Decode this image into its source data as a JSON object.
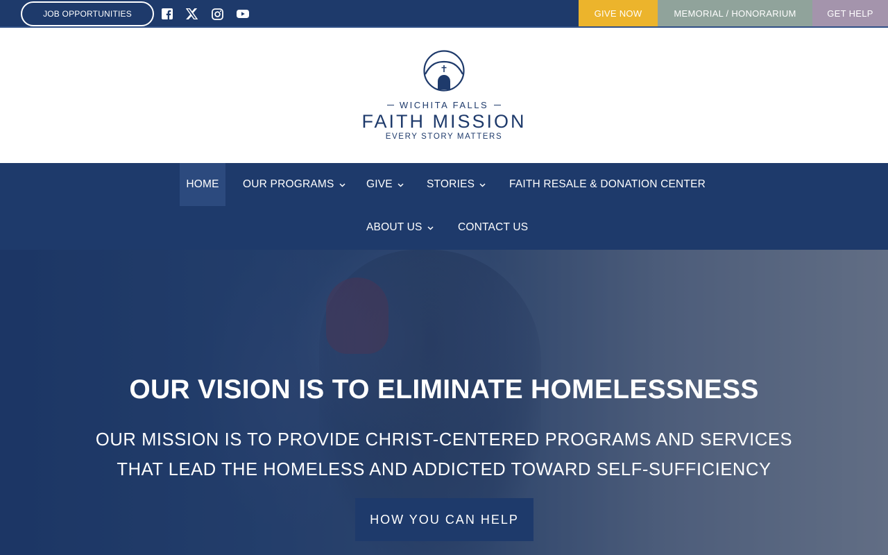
{
  "topbar": {
    "job_label": "JOB OPPORTUNITIES",
    "social_icons": [
      "facebook-icon",
      "x-icon",
      "instagram-icon",
      "youtube-icon"
    ],
    "give_now": "GIVE NOW",
    "memorial": "MEMORIAL / HONORARIUM",
    "get_help": "GET HELP"
  },
  "logo": {
    "city": "WICHITA FALLS",
    "name": "FAITH MISSION",
    "tagline": "EVERY STORY MATTERS"
  },
  "nav": {
    "items": [
      {
        "label": "HOME",
        "active": true
      },
      {
        "label": "OUR PROGRAMS",
        "dropdown": true
      },
      {
        "label": "GIVE",
        "dropdown": true
      },
      {
        "label": "STORIES",
        "dropdown": true
      },
      {
        "label": "FAITH RESALE & DONATION CENTER"
      },
      {
        "label": "ABOUT US",
        "dropdown": true
      },
      {
        "label": "CONTACT US"
      }
    ]
  },
  "hero": {
    "title": "OUR VISION IS TO ELIMINATE HOMELESSNESS",
    "subtitle_line1": "OUR MISSION IS TO PROVIDE CHRIST-CENTERED PROGRAMS AND SERVICES",
    "subtitle_line2": "THAT LEAD THE HOMELESS AND ADDICTED TOWARD SELF-SUFFICIENCY",
    "button": "HOW YOU CAN HELP"
  },
  "colors": {
    "navy": "#1e3a6b",
    "give_now": "#ecb42c",
    "memorial": "#90a39b",
    "get_help": "#a494ac"
  }
}
